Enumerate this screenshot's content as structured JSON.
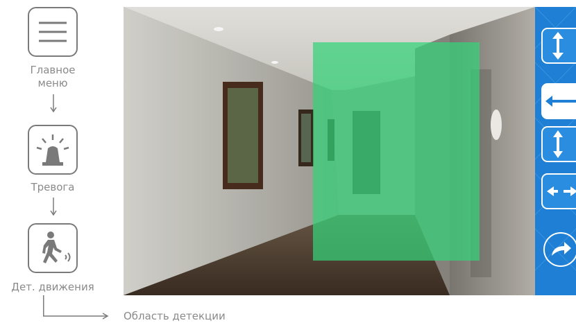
{
  "menu": {
    "main_label_line1": "Главное",
    "main_label_line2": "меню",
    "alarm_label": "Тревога",
    "motion_label": "Дет. движения"
  },
  "footer": {
    "detection_area_label": "Область детекции"
  },
  "panel": {
    "buttons": [
      {
        "icon": "vertical-resize-icon",
        "active": false
      },
      {
        "icon": "horizontal-resize-icon",
        "active": true
      },
      {
        "icon": "vertical-shrink-icon",
        "active": false
      },
      {
        "icon": "horizontal-shrink-icon",
        "active": false
      },
      {
        "icon": "next-arrow-icon",
        "active": false
      }
    ]
  },
  "colors": {
    "detection_zone": "#34d278",
    "panel_blue": "#1f7fd4",
    "icon_gray": "#7a7a7a"
  }
}
